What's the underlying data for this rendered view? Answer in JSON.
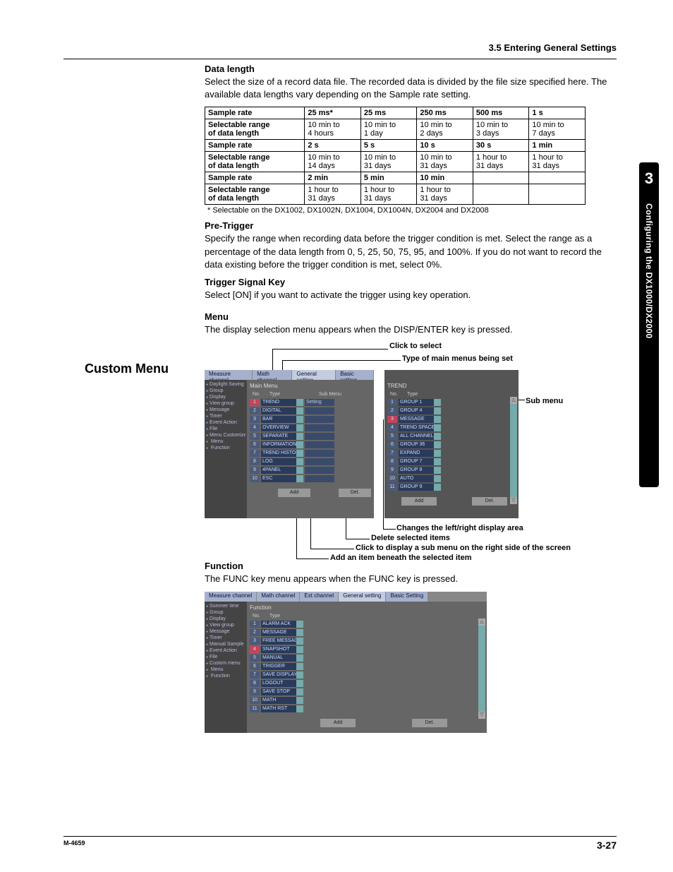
{
  "header": {
    "breadcrumb": "3.5  Entering General Settings"
  },
  "sidetab": {
    "chapter": "3",
    "title": "Configuring the DX1000/DX2000"
  },
  "section_custom_menu": "Custom Menu",
  "data_length": {
    "title": "Data length",
    "body": "Select the size of a record data file.  The recorded data is divided by the file size specified here.  The available data lengths vary depending on the Sample rate setting.",
    "table": {
      "row_labels": {
        "sample_rate": "Sample rate",
        "range_l1": "Selectable range",
        "range_l2": "of data length"
      },
      "rows": [
        {
          "rates": [
            "25 ms*",
            "25 ms",
            "250 ms",
            "500 ms",
            "1 s"
          ],
          "ranges": [
            "10 min to\n4 hours",
            "10 min to\n1 day",
            "10 min to\n2 days",
            "10 min to\n3 days",
            "10 min to\n7 days"
          ]
        },
        {
          "rates": [
            "2 s",
            "5 s",
            "10 s",
            "30 s",
            "1 min"
          ],
          "ranges": [
            "10 min to\n14 days",
            "10 min to\n31 days",
            "10 min to\n31 days",
            "1 hour to\n31 days",
            "1 hour to\n31 days"
          ]
        },
        {
          "rates": [
            "2 min",
            "5 min",
            "10 min",
            "",
            ""
          ],
          "ranges": [
            "1 hour to\n31 days",
            "1 hour to\n31 days",
            "1 hour to\n31 days",
            "",
            ""
          ]
        }
      ]
    },
    "footnote": "* Selectable on the DX1002, DX1002N, DX1004, DX1004N, DX2004 and DX2008"
  },
  "pre_trigger": {
    "title": "Pre-Trigger",
    "body": "Specify the range when recording data before the trigger condition is met.  Select the range as a percentage of the data length from 0, 5, 25, 50, 75, 95, and 100%.  If you do not want to record the data existing before the trigger condition is met, select 0%."
  },
  "trigger_key": {
    "title": "Trigger Signal Key",
    "body": "Select [ON] if you want to activate the trigger using key operation."
  },
  "menu": {
    "title": "Menu",
    "body": "The display selection menu appears when the DISP/ENTER key is pressed.",
    "callouts": {
      "click_select": "Click to select",
      "type_main": "Type of main menus being set",
      "sub_menu": "Sub menu",
      "changes_area": "Changes the left/right display area",
      "delete_sel": "Delete selected items",
      "click_sub": "Click to display a sub menu on the right side of the screen",
      "add_item": "Add an item beneath the selected item"
    },
    "panel1": {
      "tabs": [
        "Measure channel",
        "Math channel",
        "General setting",
        "Basic setting"
      ],
      "title": "Main Menu",
      "sidebar": [
        "Daylight Saving Time",
        "Group",
        "Display",
        "View group",
        "Message",
        "Timer",
        "Event Action",
        "File",
        "Menu Customize",
        "  Menu",
        "  Function"
      ],
      "cols": [
        "No.",
        "Type",
        "Sub Menu"
      ],
      "rows": [
        [
          "1",
          "TREND",
          "Setting"
        ],
        [
          "2",
          "DIGITAL",
          ""
        ],
        [
          "3",
          "BAR",
          ""
        ],
        [
          "4",
          "OVERVIEW",
          ""
        ],
        [
          "5",
          "SEPARATE",
          ""
        ],
        [
          "6",
          "INFORMATION",
          ""
        ],
        [
          "7",
          "TREND HISTORY",
          ""
        ],
        [
          "8",
          "LOG",
          ""
        ],
        [
          "9",
          "4PANEL",
          ""
        ],
        [
          "10",
          "ESC",
          ""
        ]
      ],
      "buttons": {
        "add": "Add",
        "del": "Del."
      }
    },
    "panel2": {
      "title": "TREND",
      "cols": [
        "No.",
        "Type"
      ],
      "rows": [
        [
          "1",
          "GROUP 1"
        ],
        [
          "2",
          "GROUP 4"
        ],
        [
          "3",
          "MESSAGE"
        ],
        [
          "4",
          "TREND SPACE"
        ],
        [
          "5",
          "ALL CHANNEL"
        ],
        [
          "6",
          "GROUP 36"
        ],
        [
          "7",
          "EXPAND"
        ],
        [
          "8",
          "GROUP 7"
        ],
        [
          "9",
          "GROUP 8"
        ],
        [
          "10",
          "AUTO"
        ],
        [
          "11",
          "GROUP 9"
        ]
      ],
      "buttons": {
        "add": "Add",
        "del": "Del."
      }
    }
  },
  "function_sec": {
    "title": "Function",
    "body": "The FUNC key menu appears when the FUNC key is pressed.",
    "panel": {
      "tabs": [
        "Measure channel",
        "Math channel",
        "Ext channel",
        "General setting",
        "Basic Setting"
      ],
      "title": "Function",
      "sidebar": [
        "Summer time",
        "Group",
        "Display",
        "View group",
        "Message",
        "Timer",
        "Manual Sample",
        "Event Action",
        "File",
        "Custom menu",
        "  Menu",
        "  Function"
      ],
      "cols": [
        "No.",
        "Type"
      ],
      "rows": [
        [
          "1",
          "ALARM ACK"
        ],
        [
          "2",
          "MESSAGE"
        ],
        [
          "3",
          "FREE MESSAGE"
        ],
        [
          "4",
          "SNAPSHOT"
        ],
        [
          "5",
          "MANUAL"
        ],
        [
          "6",
          "TRIGGER"
        ],
        [
          "7",
          "SAVE DISPLAY"
        ],
        [
          "8",
          "LOGOUT"
        ],
        [
          "9",
          "SAVE STOP"
        ],
        [
          "10",
          "MATH"
        ],
        [
          "11",
          "MATH RST"
        ]
      ],
      "buttons": {
        "add": "Add",
        "del": "Del."
      }
    }
  },
  "footer": {
    "left": "M-4659",
    "right": "3-27"
  }
}
